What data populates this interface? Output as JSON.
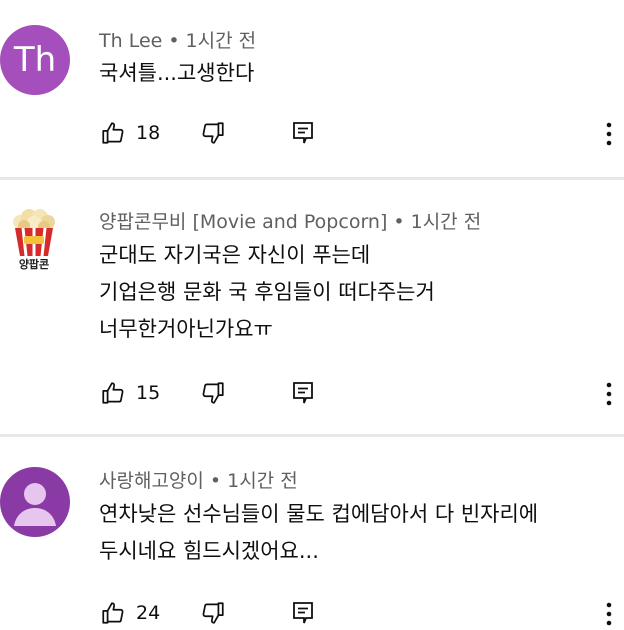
{
  "comments": [
    {
      "author": "Th Lee",
      "time": "1시간 전",
      "avatar_text": "Th",
      "text": "국셔틀...고생한다",
      "likes": "18"
    },
    {
      "author": "양팝콘무비 [Movie and Popcorn]",
      "time": "1시간 전",
      "avatar_label": "양팝콘",
      "text": "군대도 자기국은 자신이 푸는데\n기업은행 문화 국  후임들이 떠다주는거\n너무한거아닌가요ㅠ",
      "likes": "15"
    },
    {
      "author": "사랑해고양이",
      "time": "1시간 전",
      "text": "연차낮은 선수님들이 물도 컵에담아서 다 빈자리에\n두시네요 힘드시겠어요...",
      "likes": "24"
    }
  ],
  "separator": "•",
  "colors": {
    "avatar_purple": "#a54fbd",
    "avatar_person": "#8a3aa4",
    "meta_gray": "#606060",
    "divider": "#e8e8e8"
  }
}
